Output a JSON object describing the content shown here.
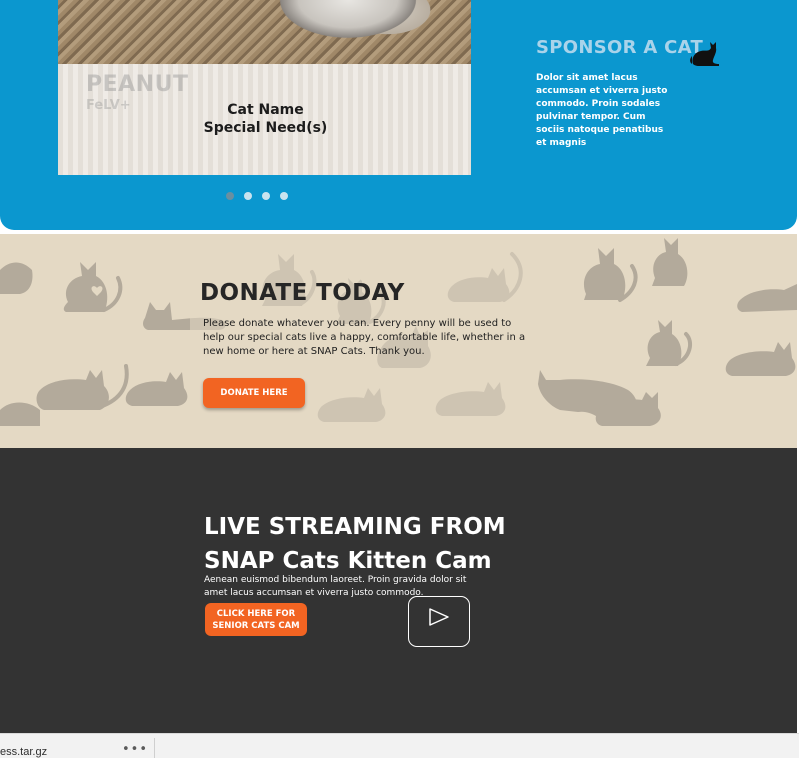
{
  "sponsor": {
    "card": {
      "name": "PEANUT",
      "condition": "FeLV+",
      "caption_line1": "Cat Name",
      "caption_line2": "Special Need(s)"
    },
    "carousel": {
      "count": 4,
      "active": 1
    },
    "title": "SPONSOR A CAT",
    "text": "Dolor sit amet lacus accumsan et viverra justo commodo. Proin sodales pulvinar tempor. Cum sociis natoque penatibus et magnis",
    "icon": "cat-silhouette-icon"
  },
  "donate": {
    "title": "DONATE TODAY",
    "text": "Please donate whatever you can. Every penny will be used to help our special cats live a happy, comfortable life, whether in a new home or here at SNAP Cats. Thank you.",
    "button_label": "DONATE HERE"
  },
  "live": {
    "title_line1": "LIVE STREAMING FROM",
    "title_line2": "SNAP Cats Kitten Cam",
    "text": "Aenean euismod bibendum laoreet. Proin gravida dolor sit amet lacus accumsan et viverra justo commodo.",
    "button_line1": "CLICK HERE FOR",
    "button_line2": "SENIOR CATS CAM",
    "play_icon": "play-icon"
  },
  "download_bar": {
    "file_name": "ess.tar.gz",
    "more_label": "•••"
  },
  "colors": {
    "hero_blue": "#0b97cf",
    "donate_bg": "#e4d9c4",
    "live_bg": "#333333",
    "accent_orange": "#f26422"
  }
}
